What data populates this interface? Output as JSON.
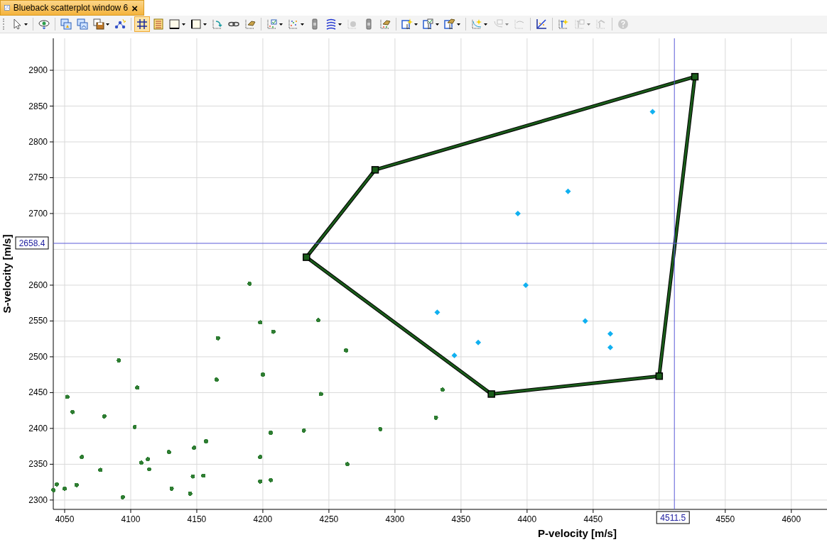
{
  "window": {
    "tab": {
      "title": "Blueback scatterplot window 6",
      "selected": true,
      "close": "×"
    }
  },
  "toolbar": [
    [
      {
        "kind": "pointer",
        "dropdown": true,
        "selected": false,
        "disabled": false
      }
    ],
    [
      {
        "kind": "eye",
        "dropdown": false,
        "selected": false,
        "disabled": false
      }
    ],
    [
      {
        "kind": "picture-up",
        "dropdown": false,
        "selected": false,
        "disabled": false
      },
      {
        "kind": "picture-copy",
        "dropdown": false,
        "selected": false,
        "disabled": false
      },
      {
        "kind": "save",
        "dropdown": true,
        "selected": false,
        "disabled": false
      },
      {
        "kind": "network",
        "dropdown": false,
        "selected": false,
        "disabled": false
      }
    ],
    [
      {
        "kind": "grid",
        "dropdown": false,
        "selected": true,
        "disabled": false
      },
      {
        "kind": "list",
        "dropdown": false,
        "selected": false,
        "disabled": false
      },
      {
        "kind": "frame",
        "dropdown": true,
        "selected": false,
        "disabled": false
      },
      {
        "kind": "frame-left",
        "dropdown": true,
        "selected": false,
        "disabled": false
      },
      {
        "kind": "rotate",
        "dropdown": false,
        "selected": false,
        "disabled": false
      },
      {
        "kind": "link",
        "dropdown": false,
        "selected": false,
        "disabled": false
      },
      {
        "kind": "hand",
        "dropdown": false,
        "selected": false,
        "disabled": false
      }
    ],
    [
      {
        "kind": "check-chart",
        "dropdown": true,
        "selected": false,
        "disabled": false
      },
      {
        "kind": "dots-chart",
        "dropdown": true,
        "selected": false,
        "disabled": false
      },
      {
        "kind": "bar",
        "dropdown": false,
        "selected": false,
        "disabled": false
      },
      {
        "kind": "contour",
        "dropdown": true,
        "selected": false,
        "disabled": false
      },
      {
        "kind": "blob",
        "dropdown": false,
        "selected": false,
        "disabled": true
      },
      {
        "kind": "bar",
        "dropdown": false,
        "selected": false,
        "disabled": false
      },
      {
        "kind": "paint-chart",
        "dropdown": false,
        "selected": false,
        "disabled": false
      }
    ],
    [
      {
        "kind": "new-select",
        "dropdown": true,
        "selected": false,
        "disabled": false
      },
      {
        "kind": "check-select",
        "dropdown": true,
        "selected": false,
        "disabled": false
      },
      {
        "kind": "paint-select",
        "dropdown": true,
        "selected": false,
        "disabled": false
      }
    ],
    [
      {
        "kind": "new-curve",
        "dropdown": true,
        "selected": false,
        "disabled": false
      },
      {
        "kind": "check-curve",
        "dropdown": true,
        "selected": false,
        "disabled": true
      },
      {
        "kind": "curve",
        "dropdown": false,
        "selected": false,
        "disabled": true
      }
    ],
    [
      {
        "kind": "diagonal",
        "dropdown": false,
        "selected": false,
        "disabled": false
      }
    ],
    [
      {
        "kind": "new-tree",
        "dropdown": false,
        "selected": false,
        "disabled": false
      },
      {
        "kind": "check-tree",
        "dropdown": true,
        "selected": false,
        "disabled": true
      },
      {
        "kind": "tree",
        "dropdown": false,
        "selected": false,
        "disabled": true
      }
    ],
    [
      {
        "kind": "help",
        "dropdown": false,
        "selected": false,
        "disabled": true
      }
    ]
  ],
  "plot": {
    "chart_data": {
      "type": "scatter",
      "xlabel": "P-velocity [m/s]",
      "ylabel": "S-velocity [m/s]",
      "xlim": [
        4041.4,
        4627
      ],
      "ylim": [
        2287,
        2944.6
      ],
      "xticks": [
        4050,
        4100,
        4150,
        4200,
        4250,
        4300,
        4350,
        4400,
        4450,
        4550,
        4600
      ],
      "yticks": [
        2300,
        2350,
        2400,
        2450,
        2500,
        2550,
        2600,
        2700,
        2750,
        2800,
        2850,
        2900
      ],
      "series": [
        {
          "color": "#2e7d32",
          "x": [
            4190,
            4198,
            4208,
            4166,
            4242,
            4263,
            4091,
            4165,
            4200,
            4244,
            4105,
            4052,
            4056,
            4080,
            4336,
            4331,
            4289,
            4231,
            4206,
            4103,
            4157,
            4148,
            4129,
            4063,
            4198,
            4113,
            4108,
            4264,
            4077,
            4114,
            4155,
            4147,
            4198,
            4206,
            4131,
            4059,
            4044,
            4050,
            4145,
            4094,
            4041.5
          ],
          "values": [
            2602,
            2548,
            2535,
            2526,
            2551,
            2509,
            2495,
            2468,
            2475,
            2448,
            2457,
            2444,
            2423,
            2417,
            2454,
            2415,
            2399,
            2397,
            2394,
            2402,
            2382,
            2373,
            2367,
            2360,
            2360,
            2357,
            2352,
            2350,
            2342,
            2343,
            2334,
            2333,
            2326,
            2328,
            2316,
            2321,
            2322,
            2316,
            2309,
            2304,
            2314
          ]
        },
        {
          "color": "#10b0f0",
          "x": [
            4495,
            4431,
            4393,
            4399,
            4332,
            4363,
            4345,
            4444,
            4463,
            4463
          ],
          "values": [
            2842,
            2731,
            2700,
            2600,
            2562,
            2520,
            2502,
            2550,
            2532,
            2513
          ]
        },
        {
          "color": "#1a5c1a",
          "x": [
            4527,
            4285,
            4233,
            4373,
            4500
          ],
          "values": [
            2891,
            2761,
            2639,
            2448,
            2473
          ]
        }
      ],
      "grid": true,
      "ref_lines": [
        {
          "axis": "x",
          "value": 4511.5,
          "label": "4511.5"
        },
        {
          "axis": "y",
          "value": 2658.4,
          "label": "2658.4"
        }
      ]
    }
  }
}
